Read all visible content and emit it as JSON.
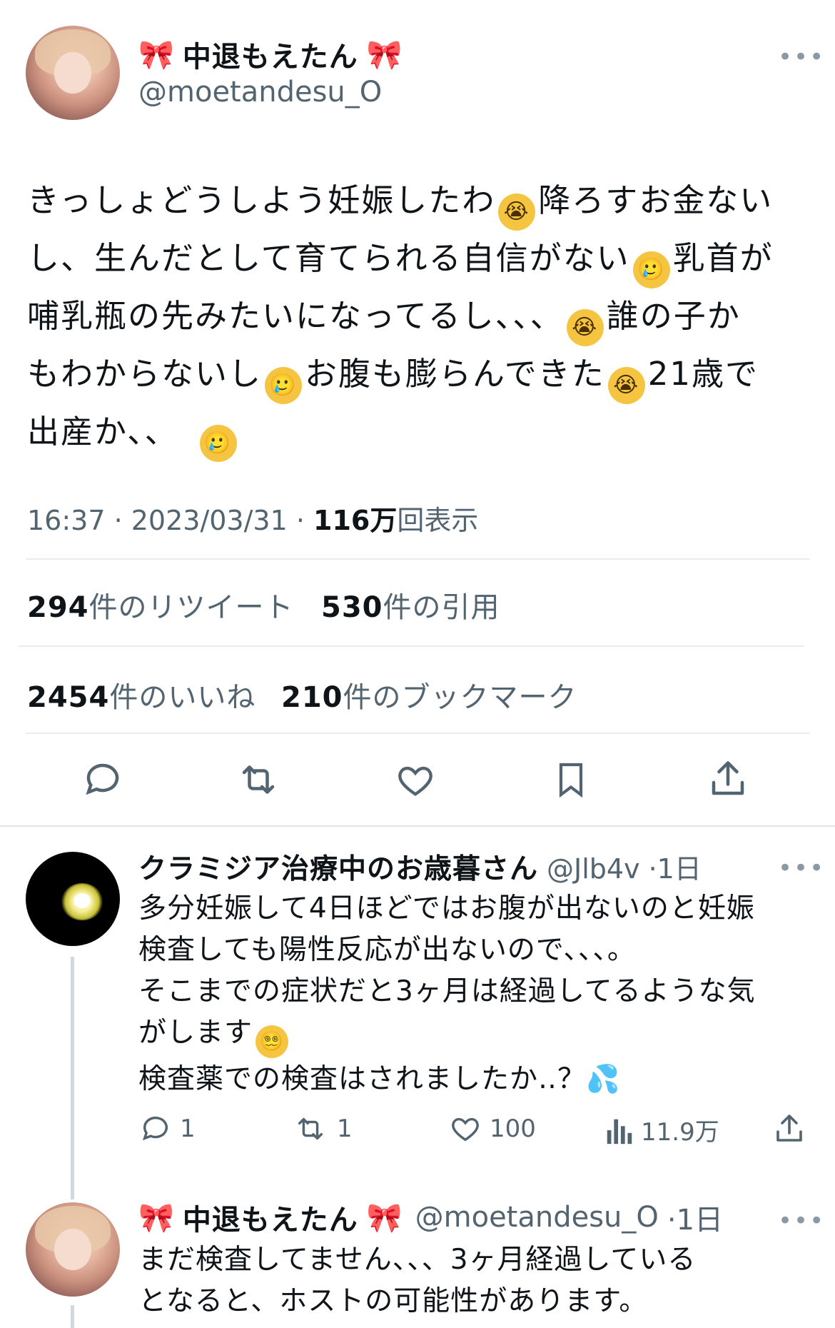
{
  "tweet": {
    "author_name": "中退もえたん",
    "bow_left": "🎀",
    "bow_right": "🎀",
    "handle": "@moetandesu_O",
    "more": "•••",
    "lines": [
      "きっしょどうしよう妊娠したわ",
      "降ろすお金ない",
      "し、生んだとして育てられる自信がない",
      "乳首が",
      "哺乳瓶の先みたいになってるし、、、",
      "誰の子か",
      "もわからないし",
      "お腹も膨らんできた",
      "21歳で",
      "出産か、、"
    ],
    "emoji": {
      "loud_crying": "😭",
      "holding_tears": "🥲",
      "dizzy": "😵‍💫",
      "sweat": "💦"
    },
    "time": "16:37 · 2023/03/31 · ",
    "views_count": "116万",
    "views_label": "回表示",
    "stats": {
      "retweets_count": "294",
      "retweets_label": "件のリツイート",
      "quotes_count": "530",
      "quotes_label": "件の引用",
      "likes_count": "2454",
      "likes_label": "件のいいね",
      "bookmarks_count": "210",
      "bookmarks_label": "件のブックマーク"
    },
    "icons": [
      "reply-icon",
      "retweet-icon",
      "like-icon",
      "bookmark-icon",
      "share-icon"
    ]
  },
  "reply1": {
    "author_name": "クラミジア治療中のお歳暮さん",
    "handle": "@Jlb4v",
    "time": "·1日",
    "more": "•••",
    "lines": [
      "多分妊娠して4日ほどではお腹が出ないのと妊娠",
      "検査しても陽性反応が出ないので、、、。",
      "そこまでの症状だと3ヶ月は経過してるような気",
      "がします",
      "検査薬での検査はされましたか‥？"
    ],
    "actions": {
      "replies": "1",
      "retweets": "1",
      "likes": "100",
      "views": "11.9万"
    }
  },
  "reply2": {
    "author_name": "中退もえたん",
    "handle": "@moetandesu_O",
    "time": "·1日",
    "more": "•••",
    "lines": [
      "まだ検査してません、、、3ヶ月経過している",
      "となると、ホストの可能性があります。"
    ]
  },
  "colors": {
    "text": "#0f1419",
    "secondary": "#536471",
    "divider": "#e6ecf0",
    "bow": "#e7869f"
  }
}
